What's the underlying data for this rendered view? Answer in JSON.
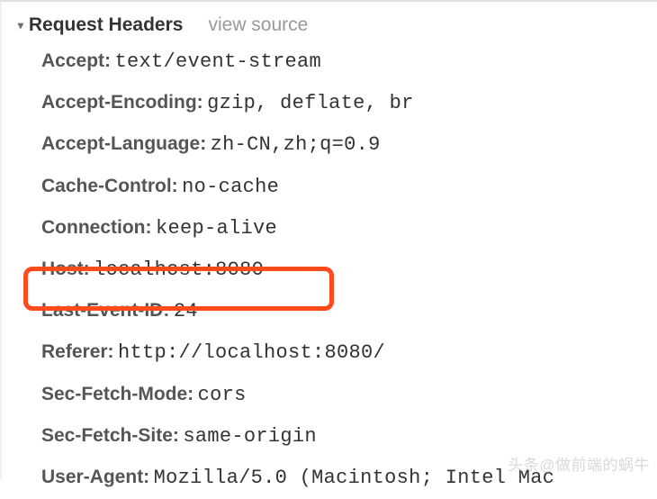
{
  "section": {
    "title": "Request Headers",
    "view_source": "view source"
  },
  "headers": [
    {
      "name": "Accept:",
      "value": "text/event-stream"
    },
    {
      "name": "Accept-Encoding:",
      "value": "gzip, deflate, br"
    },
    {
      "name": "Accept-Language:",
      "value": "zh-CN,zh;q=0.9"
    },
    {
      "name": "Cache-Control:",
      "value": "no-cache"
    },
    {
      "name": "Connection:",
      "value": "keep-alive"
    },
    {
      "name": "Host:",
      "value": "localhost:8080"
    },
    {
      "name": "Last-Event-ID:",
      "value": "24"
    },
    {
      "name": "Referer:",
      "value": "http://localhost:8080/"
    },
    {
      "name": "Sec-Fetch-Mode:",
      "value": "cors"
    },
    {
      "name": "Sec-Fetch-Site:",
      "value": "same-origin"
    },
    {
      "name": "User-Agent:",
      "value": "Mozilla/5.0 (Macintosh; Intel Mac"
    }
  ],
  "highlighted_header": "Last-Event-ID",
  "watermark": "头条@做前端的蜗牛"
}
